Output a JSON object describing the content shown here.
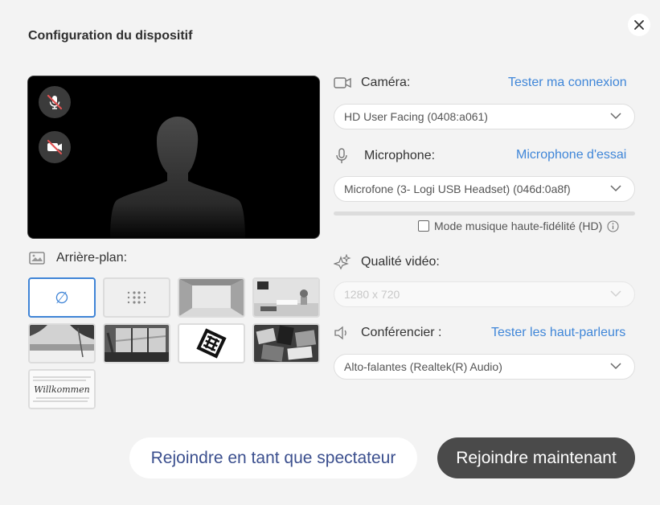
{
  "dialog": {
    "title": "Configuration du dispositif",
    "close_icon": "close-icon"
  },
  "preview": {
    "mic_state": "muted",
    "camera_state": "off"
  },
  "background": {
    "label": "Arrière-plan:",
    "none_symbol": "∅",
    "willkommen_text": "Willkommen",
    "selected": "none"
  },
  "camera": {
    "label": "Caméra:",
    "link": "Tester ma connexion",
    "value": "HD User Facing (0408:a061)"
  },
  "microphone": {
    "label": "Microphone:",
    "link": "Microphone d'essai",
    "value": "Microfone (3- Logi USB Headset) (046d:0a8f)",
    "hifi_label": "Mode musique haute-fidélité (HD)",
    "hifi_checked": false
  },
  "video_quality": {
    "label": "Qualité vidéo:",
    "value": "1280 x 720",
    "disabled": true
  },
  "speaker": {
    "label": "Conférencier :",
    "link": "Tester les haut-parleurs",
    "value": "Alto-falantes (Realtek(R) Audio)"
  },
  "actions": {
    "spectator": "Rejoindre en tant que spectateur",
    "join": "Rejoindre maintenant"
  }
}
